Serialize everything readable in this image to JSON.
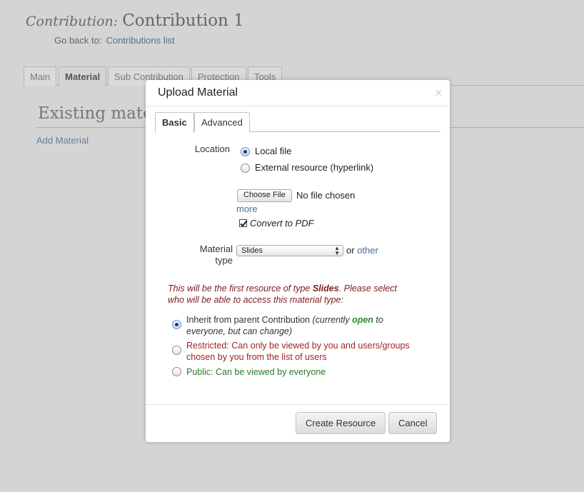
{
  "page": {
    "contribution_label": "Contribution:",
    "contribution_title": "Contribution 1",
    "go_back_label": "Go back to:",
    "go_back_link": "Contributions list",
    "tabs": [
      "Main",
      "Material",
      "Sub Contribution",
      "Protection",
      "Tools"
    ],
    "active_tab": "Material",
    "section_title": "Existing materials",
    "add_material": "Add Material"
  },
  "modal": {
    "title": "Upload Material",
    "close_icon": "close-icon",
    "tabs": [
      "Basic",
      "Advanced"
    ],
    "active_tab": "Basic",
    "location": {
      "label": "Location",
      "options": [
        "Local file",
        "External resource (hyperlink)"
      ],
      "selected": "Local file"
    },
    "file": {
      "choose_button": "Choose File",
      "status": "No file chosen",
      "more_link": "more",
      "convert_label": "Convert to PDF",
      "convert_checked": true
    },
    "material_type": {
      "label_line1": "Material",
      "label_line2": "type",
      "selected": "Slides",
      "or_text": "or",
      "other_link": "other"
    },
    "warning": {
      "prefix": "This will be the first resource of type ",
      "type": "Slides",
      "suffix": ". Please select",
      "line2": "who will be able to access this material type:"
    },
    "access": {
      "inherit_main": "Inherit from parent Contribution ",
      "inherit_paren_open": "(currently ",
      "inherit_status": "open",
      "inherit_paren_rest": " to",
      "inherit_line2": "everyone, but can change)",
      "restricted_line1": "Restricted: Can only be viewed by you and users/groups",
      "restricted_line2": "chosen by you from the list of users",
      "public": "Public: Can be viewed by everyone",
      "selected": "inherit"
    },
    "buttons": {
      "create": "Create Resource",
      "cancel": "Cancel"
    },
    "colors": {
      "warning": "#7a1d1d",
      "restricted": "#a12424",
      "public": "#2a7a2a",
      "status_open": "#2a8a2a",
      "link": "#4a6c9b"
    }
  }
}
